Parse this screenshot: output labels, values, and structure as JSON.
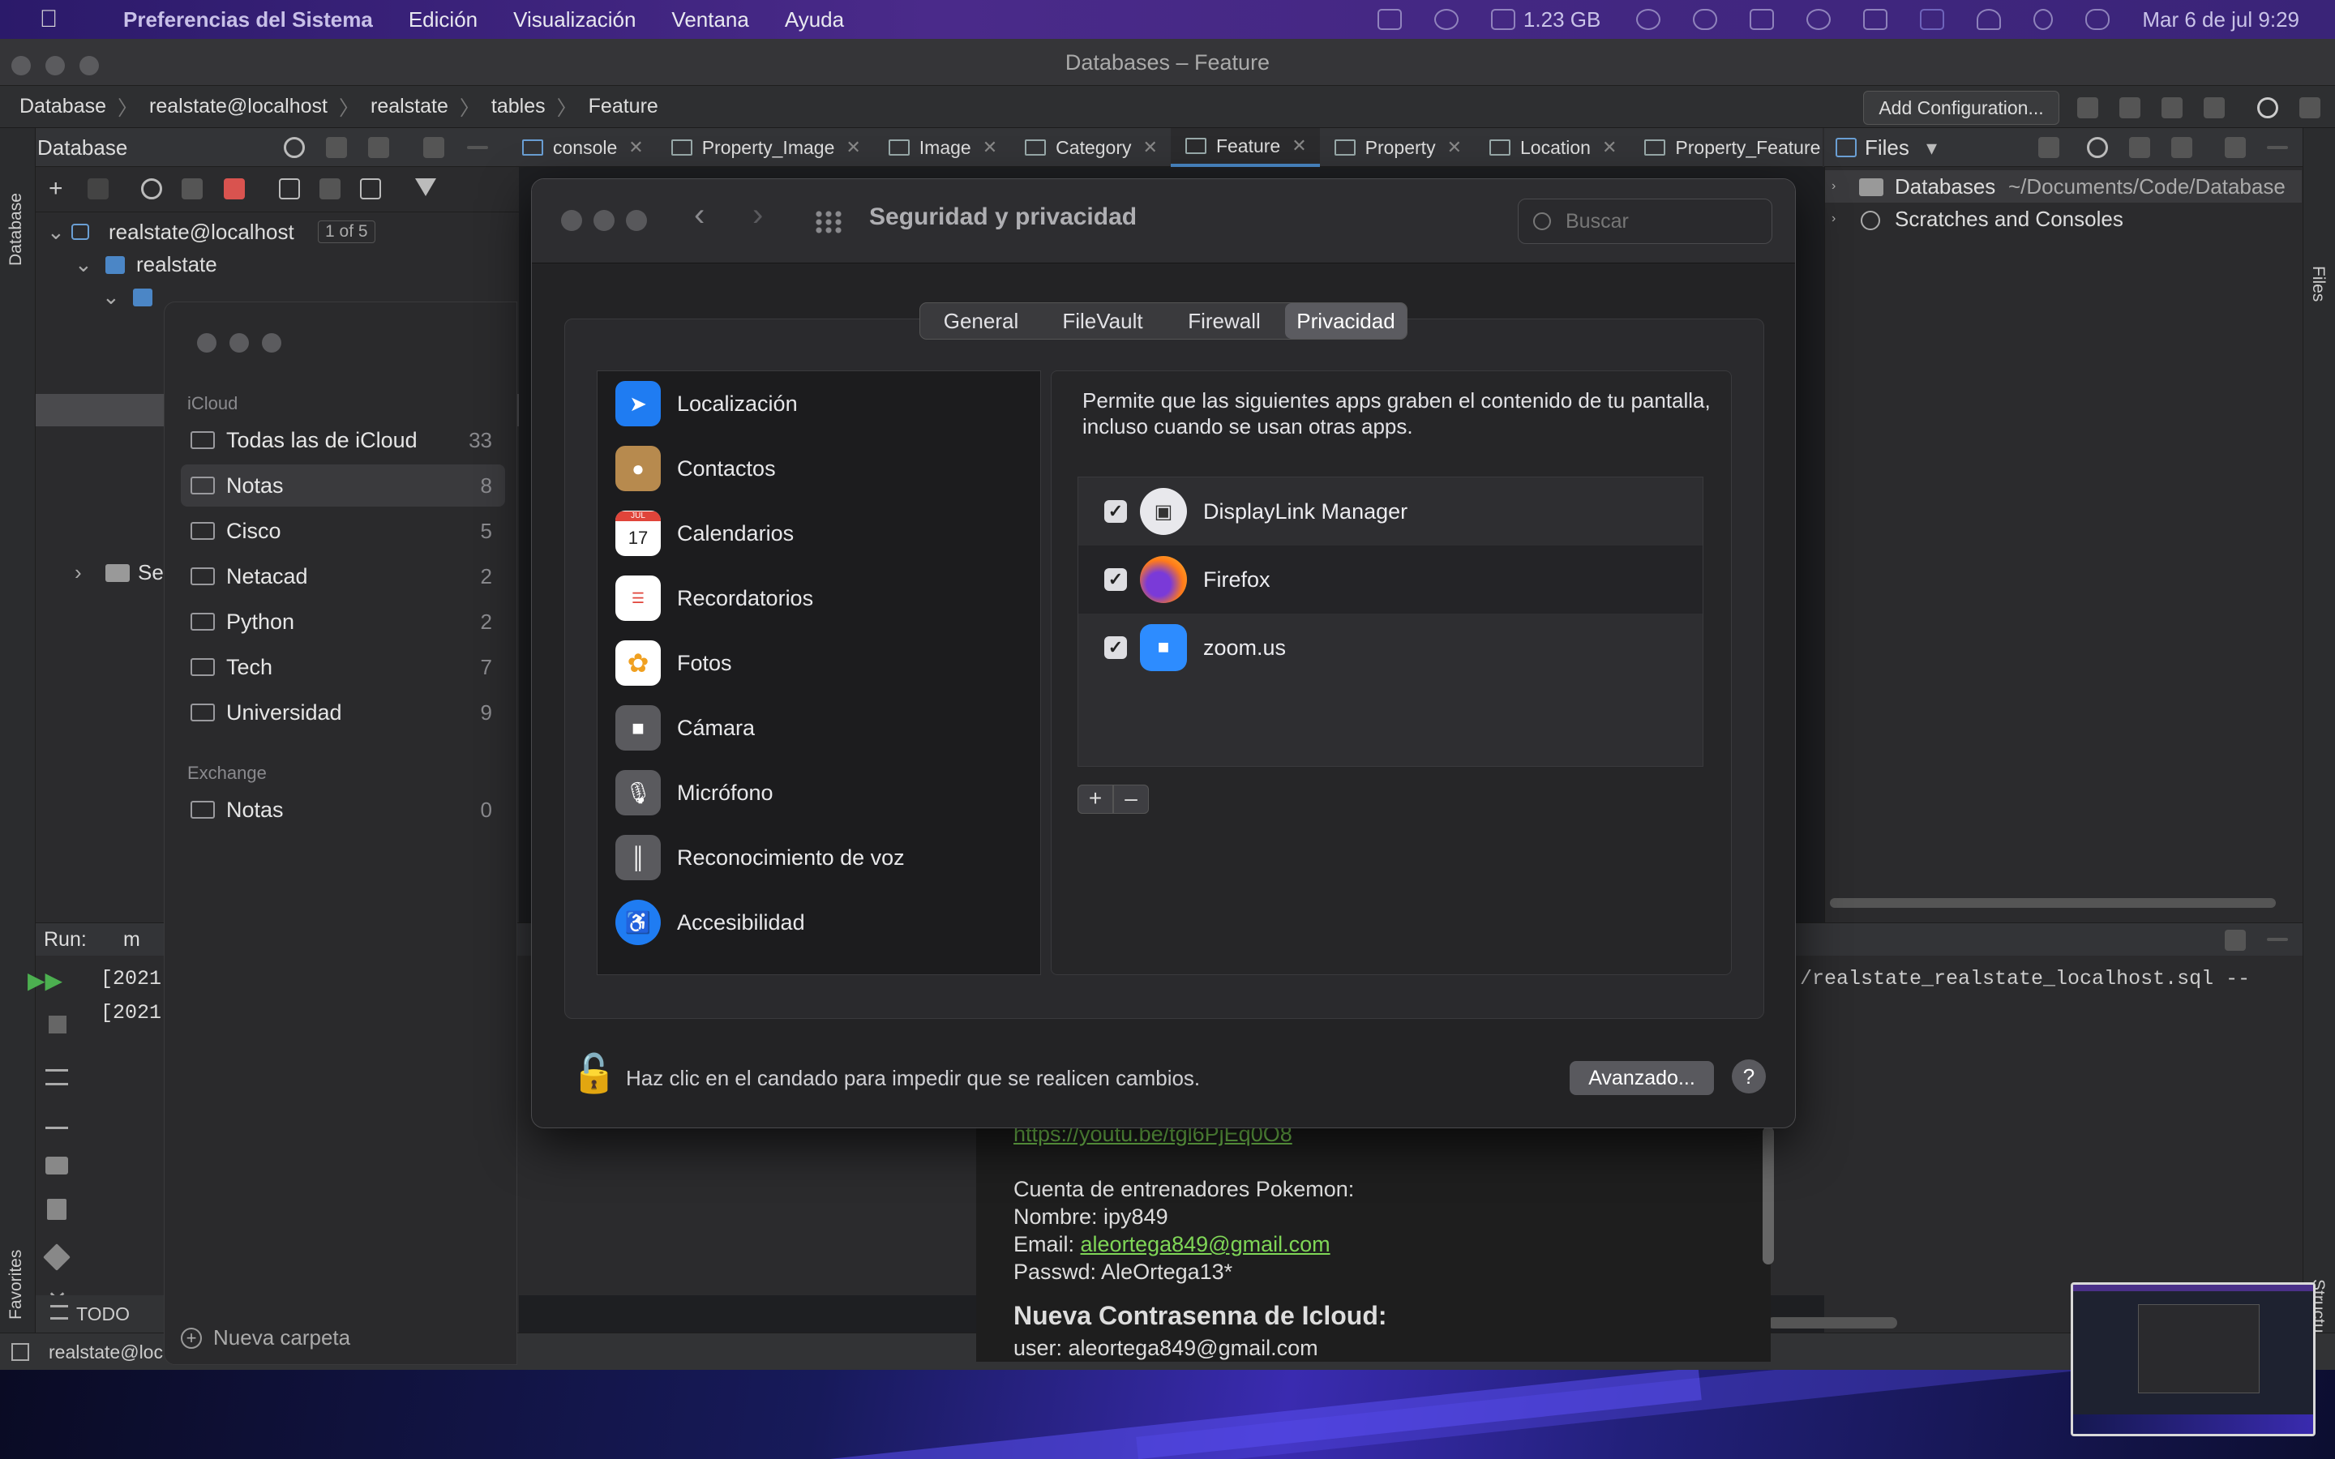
{
  "menubar": {
    "app": "Preferencias del Sistema",
    "menus": [
      "Edición",
      "Visualización",
      "Ventana",
      "Ayuda"
    ],
    "memory": "1.23 GB",
    "datetime": "Mar 6 de jul  9:29"
  },
  "ide": {
    "window_title": "Databases – Feature",
    "breadcrumbs": [
      "Database",
      "realstate@localhost",
      "realstate",
      "tables",
      "Feature"
    ],
    "add_config": "Add Configuration...",
    "db_panel_title": "Database",
    "left_strip_label": "Database",
    "favorites_label": "Favorites",
    "tree": {
      "root": "realstate@localhost",
      "root_badge": "1 of 5",
      "schema": "realstate",
      "partial": "Se"
    },
    "tabs": [
      "console",
      "Property_Image",
      "Image",
      "Category",
      "Feature",
      "Property",
      "Location",
      "Property_Feature"
    ],
    "files_panel": {
      "title": "Files",
      "items": [
        {
          "name": "Databases",
          "path": "~/Documents/Code/Database"
        },
        {
          "name": "Scratches and Consoles",
          "path": ""
        }
      ]
    },
    "right_strip_labels": [
      "Files",
      "Structure"
    ],
    "run": {
      "label": "Run:",
      "partial": "m",
      "log_lines": [
        "[2021",
        "[2021"
      ],
      "output": "/realstate_realstate_localhost.sql --"
    },
    "status": {
      "todo": "TODO",
      "connection": "realstate@loc"
    }
  },
  "notes": {
    "sections": [
      {
        "title": "iCloud",
        "folders": [
          {
            "name": "Todas las de iCloud",
            "count": "33"
          },
          {
            "name": "Notas",
            "count": "8"
          },
          {
            "name": "Cisco",
            "count": "5"
          },
          {
            "name": "Netacad",
            "count": "2"
          },
          {
            "name": "Python",
            "count": "2"
          },
          {
            "name": "Tech",
            "count": "7"
          },
          {
            "name": "Universidad",
            "count": "9"
          }
        ]
      },
      {
        "title": "Exchange",
        "folders": [
          {
            "name": "Notas",
            "count": "0"
          }
        ]
      }
    ],
    "new_folder": "Nueva carpeta",
    "content": {
      "link": "https://youtu.be/tgl6PjEq0O8",
      "line1": "Cuenta de entrenadores Pokemon:",
      "line2": "Nombre: ipy849",
      "line3_label": "Email: ",
      "line3_email": "aleortega849@gmail.com",
      "line4": "Passwd: AleOrtega13*",
      "heading": "Nueva Contrasenna de Icloud:",
      "line5": "user: aleortega849@gmail.com"
    }
  },
  "prefs": {
    "title": "Seguridad y privacidad",
    "search_placeholder": "Buscar",
    "tabs": [
      "General",
      "FileVault",
      "Firewall",
      "Privacidad"
    ],
    "selected_tab": "Privacidad",
    "categories": [
      {
        "label": "Localización",
        "icon": "location-arrow-icon",
        "color": "#1f7cf2"
      },
      {
        "label": "Contactos",
        "icon": "contacts-icon",
        "color": "#b78a4e"
      },
      {
        "label": "Calendarios",
        "icon": "calendar-icon",
        "color": "#ffffff"
      },
      {
        "label": "Recordatorios",
        "icon": "reminders-icon",
        "color": "#ffffff"
      },
      {
        "label": "Fotos",
        "icon": "photos-icon",
        "color": "#ffffff"
      },
      {
        "label": "Cámara",
        "icon": "camera-icon",
        "color": "#5a5a5e"
      },
      {
        "label": "Micrófono",
        "icon": "microphone-icon",
        "color": "#5a5a5e"
      },
      {
        "label": "Reconocimiento de voz",
        "icon": "waveform-icon",
        "color": "#5a5a5e"
      },
      {
        "label": "Accesibilidad",
        "icon": "accessibility-icon",
        "color": "#1f7cf2"
      }
    ],
    "calendar_month": "JUL",
    "calendar_day": "17",
    "description": "Permite que las siguientes apps graben el contenido de tu pantalla, incluso cuando se usan otras apps.",
    "apps": [
      {
        "name": "DisplayLink Manager",
        "checked": true,
        "icon": "displaylink-icon"
      },
      {
        "name": "Firefox",
        "checked": true,
        "icon": "firefox-icon"
      },
      {
        "name": "zoom.us",
        "checked": true,
        "icon": "zoom-icon"
      }
    ],
    "add_label": "+",
    "remove_label": "–",
    "lock_text": "Haz clic en el candado para impedir que se realicen cambios.",
    "advanced": "Avanzado...",
    "help": "?"
  }
}
